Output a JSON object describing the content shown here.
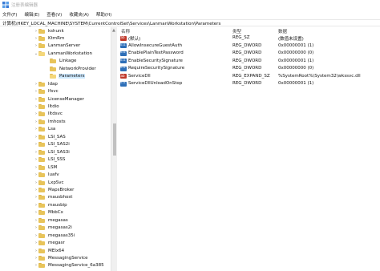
{
  "window": {
    "title": "注册表编辑器"
  },
  "menu": [
    "文件(F)",
    "编辑(E)",
    "查看(V)",
    "收藏夹(A)",
    "帮助(H)"
  ],
  "address": "计算机\\HKEY_LOCAL_MACHINE\\SYSTEM\\CurrentControlSet\\Services\\LanmanWorkstation\\Parameters",
  "tree": [
    {
      "label": "kshunk",
      "level": 0,
      "expandable": true
    },
    {
      "label": "KtmRm",
      "level": 0,
      "expandable": true
    },
    {
      "label": "LanmanServer",
      "level": 0,
      "expandable": true
    },
    {
      "label": "LanmanWorkstation",
      "level": 0,
      "expandable": true,
      "expanded": true
    },
    {
      "label": "Linkage",
      "level": 1,
      "expandable": false
    },
    {
      "label": "NetworkProvider",
      "level": 1,
      "expandable": false
    },
    {
      "label": "Parameters",
      "level": 1,
      "expandable": false,
      "selected": true
    },
    {
      "label": "ldap",
      "level": 0,
      "expandable": true
    },
    {
      "label": "lfsvc",
      "level": 0,
      "expandable": true
    },
    {
      "label": "LicenseManager",
      "level": 0,
      "expandable": true
    },
    {
      "label": "lltdio",
      "level": 0,
      "expandable": true
    },
    {
      "label": "lltdsvc",
      "level": 0,
      "expandable": true
    },
    {
      "label": "lmhosts",
      "level": 0,
      "expandable": true
    },
    {
      "label": "Lsa",
      "level": 0,
      "expandable": true
    },
    {
      "label": "LSI_SAS",
      "level": 0,
      "expandable": true
    },
    {
      "label": "LSI_SAS2i",
      "level": 0,
      "expandable": true
    },
    {
      "label": "LSI_SAS3i",
      "level": 0,
      "expandable": true
    },
    {
      "label": "LSI_SSS",
      "level": 0,
      "expandable": true
    },
    {
      "label": "LSM",
      "level": 0,
      "expandable": true
    },
    {
      "label": "luafv",
      "level": 0,
      "expandable": true
    },
    {
      "label": "LxpSvc",
      "level": 0,
      "expandable": true
    },
    {
      "label": "MapsBroker",
      "level": 0,
      "expandable": true
    },
    {
      "label": "mausbhost",
      "level": 0,
      "expandable": true
    },
    {
      "label": "mausbip",
      "level": 0,
      "expandable": true
    },
    {
      "label": "MbbCx",
      "level": 0,
      "expandable": true
    },
    {
      "label": "megasas",
      "level": 0,
      "expandable": true
    },
    {
      "label": "megasas2i",
      "level": 0,
      "expandable": true
    },
    {
      "label": "megasas35i",
      "level": 0,
      "expandable": true
    },
    {
      "label": "megasr",
      "level": 0,
      "expandable": true
    },
    {
      "label": "MEIx64",
      "level": 0,
      "expandable": true
    },
    {
      "label": "MessagingService",
      "level": 0,
      "expandable": true
    },
    {
      "label": "MessagingService_6a385",
      "level": 0,
      "expandable": true
    }
  ],
  "columns": {
    "name": "名称",
    "type": "类型",
    "data": "数据"
  },
  "values": [
    {
      "name": "(默认)",
      "type": "REG_SZ",
      "data": "(数值未设置)",
      "icon": "string-value-icon"
    },
    {
      "name": "AllowInsecureGuestAuth",
      "type": "REG_DWORD",
      "data": "0x00000001 (1)",
      "icon": "dword-value-icon"
    },
    {
      "name": "EnablePlainTextPassword",
      "type": "REG_DWORD",
      "data": "0x00000000 (0)",
      "icon": "dword-value-icon"
    },
    {
      "name": "EnableSecuritySignature",
      "type": "REG_DWORD",
      "data": "0x00000001 (1)",
      "icon": "dword-value-icon"
    },
    {
      "name": "RequireSecuritySignature",
      "type": "REG_DWORD",
      "data": "0x00000000 (0)",
      "icon": "dword-value-icon"
    },
    {
      "name": "ServiceDll",
      "type": "REG_EXPAND_SZ",
      "data": "%SystemRoot%\\System32\\wkssvc.dll",
      "icon": "string-value-icon"
    },
    {
      "name": "ServiceDllUnloadOnStop",
      "type": "REG_DWORD",
      "data": "0x00000001 (1)",
      "icon": "dword-value-icon"
    }
  ]
}
